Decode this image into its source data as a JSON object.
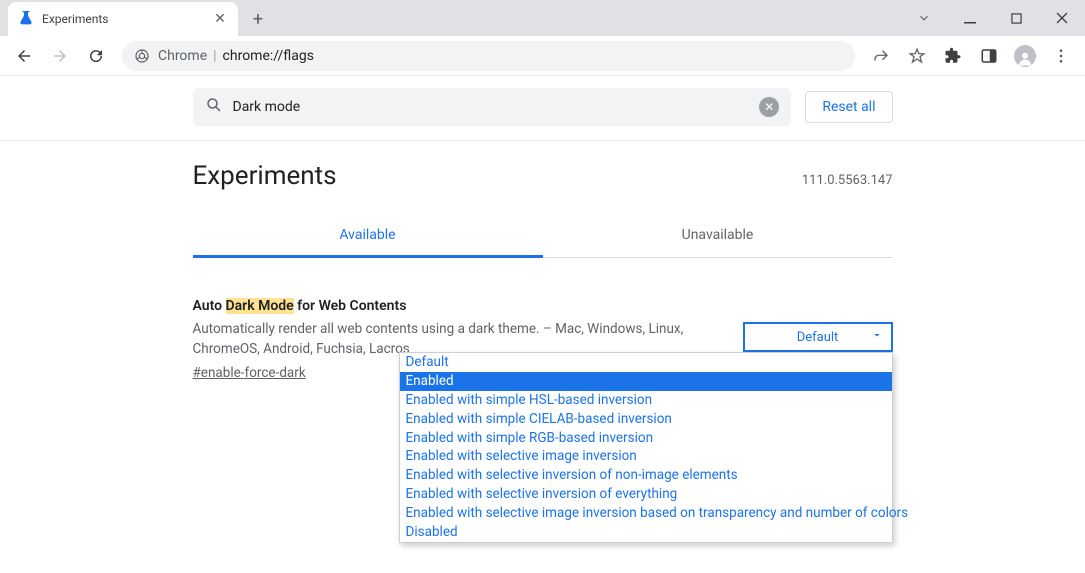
{
  "window": {
    "tab_title": "Experiments"
  },
  "omnibox": {
    "proto": "Chrome",
    "url": "chrome://flags"
  },
  "search": {
    "value": "Dark mode"
  },
  "buttons": {
    "reset": "Reset all"
  },
  "page": {
    "heading": "Experiments",
    "version": "111.0.5563.147"
  },
  "tabs": {
    "available": "Available",
    "unavailable": "Unavailable"
  },
  "flag": {
    "title_pre": "Auto ",
    "title_hl": "Dark Mode",
    "title_post": " for Web Contents",
    "desc": "Automatically render all web contents using a dark theme. – Mac, Windows, Linux, ChromeOS, Android, Fuchsia, Lacros",
    "hash": "#enable-force-dark",
    "selected": "Default"
  },
  "options": [
    "Default",
    "Enabled",
    "Enabled with simple HSL-based inversion",
    "Enabled with simple CIELAB-based inversion",
    "Enabled with simple RGB-based inversion",
    "Enabled with selective image inversion",
    "Enabled with selective inversion of non-image elements",
    "Enabled with selective inversion of everything",
    "Enabled with selective image inversion based on transparency and number of colors",
    "Disabled"
  ],
  "highlighted_option_index": 1
}
